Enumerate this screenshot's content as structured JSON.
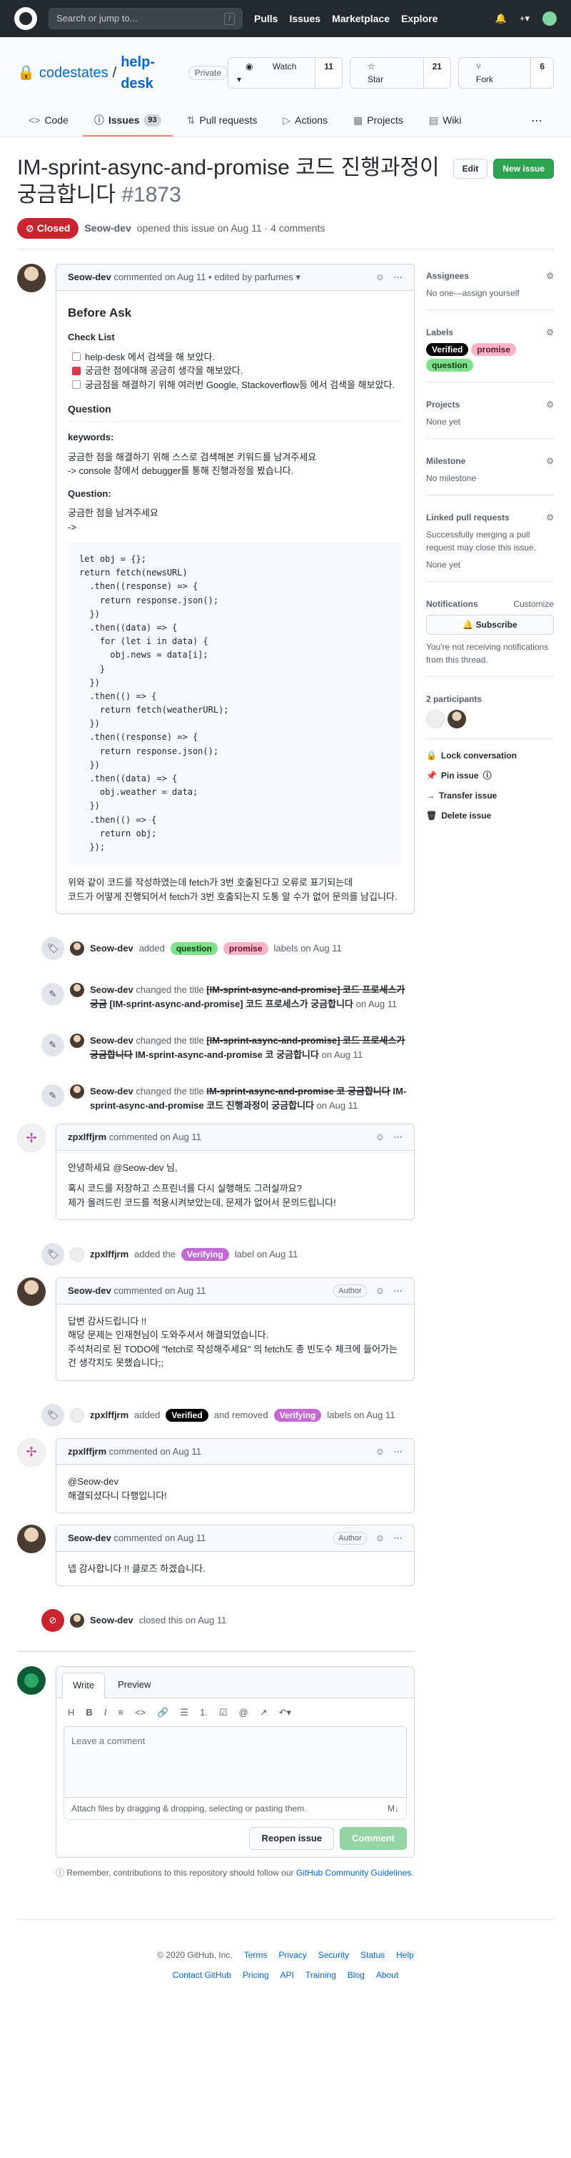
{
  "header": {
    "search_placeholder": "Search or jump to...",
    "search_key": "/",
    "nav": [
      "Pulls",
      "Issues",
      "Marketplace",
      "Explore"
    ],
    "plus": "+▾"
  },
  "repo": {
    "owner": "codestates",
    "sep": "/",
    "name": "help-desk",
    "visibility": "Private",
    "watch": {
      "label": "Watch ▾",
      "count": "11"
    },
    "star": {
      "label": "Star",
      "count": "21"
    },
    "fork": {
      "label": "Fork",
      "count": "6"
    }
  },
  "tabs": [
    {
      "label": "Code",
      "icon": "<>"
    },
    {
      "label": "Issues",
      "icon": "ⓘ",
      "count": "93"
    },
    {
      "label": "Pull requests",
      "icon": "⇅"
    },
    {
      "label": "Actions",
      "icon": "▷"
    },
    {
      "label": "Projects",
      "icon": "▦"
    },
    {
      "label": "Wiki",
      "icon": "▤"
    }
  ],
  "issue": {
    "title": "IM-sprint-async-and-promise 코드 진행과정이 궁금합니다",
    "number": "#1873",
    "edit": "Edit",
    "new_issue": "New issue",
    "state": "Closed",
    "author": "Seow-dev",
    "meta": "opened this issue on Aug 11 · 4 comments"
  },
  "c1": {
    "author": "Seow-dev",
    "head": "commented on Aug 11 • edited by parfumes ▾",
    "h_before": "Before Ask",
    "h_check": "Check List",
    "checks": [
      "help-desk 에서 검색을 해 보았다.",
      "궁금한 점에대해 공금히 생각을 해보았다.",
      "궁금점을 해결하기 위해 여러번 Google, Stackoverflow등 에서 검색을 해보았다."
    ],
    "h_q": "Question",
    "kw": "keywords:",
    "kw1": "궁금한 점을 해결하기 위해 스스로 검색해본 키워드를 남겨주세요",
    "kw2": "-> console 창에서 debugger를 통해 진행과정을 봤습니다.",
    "q": "Question:",
    "q1": "궁금한 점을 남겨주세요",
    "q2": "->",
    "code": "let obj = {};\nreturn fetch(newsURL)\n  .then((response) => {\n    return response.json();\n  })\n  .then((data) => {\n    for (let i in data) {\n      obj.news = data[i];\n    }\n  })\n  .then(() => {\n    return fetch(weatherURL);\n  })\n  .then((response) => {\n    return response.json();\n  })\n  .then((data) => {\n    obj.weather = data;\n  })\n  .then(() => {\n    return obj;\n  });",
    "tail1": "위와 같이 코드를 작성하였는데 fetch가 3번 호출된다고 오류로 표기되는데",
    "tail2": "코드가 어떻게 진행되어서 fetch가 3번 호출되는지 도통 알 수가 없어 문의를 남깁니다."
  },
  "ev1": {
    "actor": "Seow-dev",
    "pre": "added",
    "l1": "question",
    "l2": "promise",
    "post": "labels on Aug 11"
  },
  "ev2": {
    "actor": "Seow-dev",
    "pre": "changed the title",
    "old": "[IM-sprint-async-and-promise] 코드 프로세스가 궁금",
    "new": "[IM-sprint-async-and-promise] 코드 프로세스가 궁금합니다",
    "post": "on Aug 11"
  },
  "ev3": {
    "actor": "Seow-dev",
    "pre": "changed the title",
    "old": "[IM-sprint-async-and-promise] 코드 프로세스가 궁금합니다",
    "new": "IM-sprint-async-and-promise 코 궁금합니다",
    "post": "on Aug 11"
  },
  "ev4": {
    "actor": "Seow-dev",
    "pre": "changed the title",
    "old": "IM-sprint-async-and-promise 코 궁금합니다",
    "new": "IM-sprint-async-and-promise 코드 진행과정이 궁금합니다",
    "post": "on Aug 11"
  },
  "c2": {
    "author": "zpxlffjrm",
    "head": "commented on Aug 11",
    "l1": "안녕하세요 @Seow-dev 님,",
    "l2": "혹시 코드를 저장하고 스프린너를 다시 실행해도 그러실까요?",
    "l3": "제가 올려드린 코드를 적용시켜보았는데, 문제가 없어서 문의드립니다!"
  },
  "ev5": {
    "actor": "zpxlffjrm",
    "pre": "added the",
    "l1": "Verifying",
    "post": "label on Aug 11"
  },
  "c3": {
    "author": "Seow-dev",
    "head": "commented on Aug 11",
    "role": "Author",
    "l1": "답변 감사드립니다 !!",
    "l2": "해당 문제는 인재현님이 도와주셔서 해결되었습니다.",
    "l3": "주석처리로 된 TODO에 \"fetch로 작성해주세요\" 의 fetch도 총 빈도수 체크에 들어가는건 생각치도 못했습니다;;"
  },
  "ev6": {
    "actor": "zpxlffjrm",
    "pre": "added",
    "l1": "Verified",
    "mid": "and removed",
    "l2": "Verifying",
    "post": "labels on Aug 11"
  },
  "c4": {
    "author": "zpxlffjrm",
    "head": "commented on Aug 11",
    "l1": "@Seow-dev",
    "l2": "해결되셨다니 다행입니다!"
  },
  "c5": {
    "author": "Seow-dev",
    "head": "commented on Aug 11",
    "role": "Author",
    "l1": "넵 감사합니다 !! 클로즈 하겠습니다."
  },
  "ev7": {
    "actor": "Seow-dev",
    "post": "closed this on Aug 11"
  },
  "newcomment": {
    "write": "Write",
    "preview": "Preview",
    "tools": [
      "H",
      "B",
      "I",
      "≡",
      "<>",
      "🔗",
      "☰",
      "1.",
      "☑",
      "@",
      "↗",
      "↶▾"
    ],
    "placeholder": "Leave a comment",
    "attach": "Attach files by dragging & dropping, selecting or pasting them.",
    "md": "M↓",
    "reopen": "Reopen issue",
    "comment": "Comment",
    "remember": "Remember, contributions to this repository should follow our",
    "guidelines": "GitHub Community Guidelines."
  },
  "sidebar": {
    "assignees": "Assignees",
    "assignees_v": "No one—assign yourself",
    "labels": "Labels",
    "labels_v": [
      {
        "name": "Verified",
        "bg": "#000000",
        "fg": "#ffffff"
      },
      {
        "name": "promise",
        "bg": "#f9b3c7",
        "fg": "#5a1a2a"
      },
      {
        "name": "question",
        "bg": "#7ee08a",
        "fg": "#0e3a12"
      }
    ],
    "projects": "Projects",
    "projects_v": "None yet",
    "milestone": "Milestone",
    "milestone_v": "No milestone",
    "linked": "Linked pull requests",
    "linked_d": "Successfully merging a pull request may close this issue.",
    "linked_v": "None yet",
    "notif": "Notifications",
    "customize": "Customize",
    "subscribe": "Subscribe",
    "notif_d": "You're not receiving notifications from this thread.",
    "participants": "2 participants",
    "lock": "Lock conversation",
    "pin": "Pin issue",
    "transfer": "Transfer issue",
    "delete": "Delete issue"
  },
  "footer": {
    "copy": "© 2020 GitHub, Inc.",
    "row1": [
      "Terms",
      "Privacy",
      "Security",
      "Status",
      "Help"
    ],
    "row2": [
      "Contact GitHub",
      "Pricing",
      "API",
      "Training",
      "Blog",
      "About"
    ]
  },
  "colors": {
    "question": "#7ee08a",
    "promise": "#f9b3c7",
    "verifying": "#c46ad6",
    "verified": "#000000",
    "closed": "#cb2431"
  }
}
